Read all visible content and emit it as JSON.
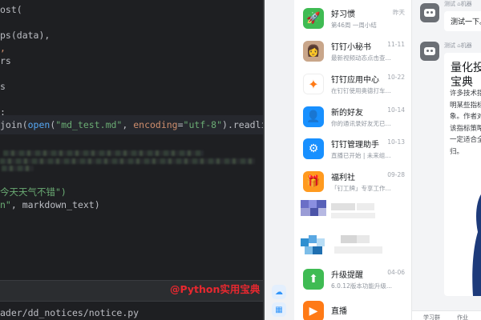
{
  "editor": {
    "code_lines": [
      {
        "id": "l1",
        "parts": [
          [
            "",
            "ost("
          ]
        ]
      },
      {
        "id": "l2",
        "parts": [
          [
            "",
            "ps(data),"
          ]
        ]
      },
      {
        "id": "l3",
        "parts": [
          [
            "tok-orange",
            ","
          ]
        ]
      },
      {
        "id": "l4",
        "parts": [
          [
            "",
            "rs"
          ]
        ]
      },
      {
        "id": "l5",
        "parts": [
          [
            "",
            "s"
          ]
        ]
      },
      {
        "id": "l6",
        "parts": [
          [
            "",
            ":"
          ]
        ]
      },
      {
        "id": "l7",
        "parts": [
          [
            "",
            "join("
          ],
          [
            "tok-fn",
            "open"
          ],
          [
            "",
            "("
          ],
          [
            "tok-str",
            "\"md_test.md\""
          ],
          [
            "",
            ", "
          ],
          [
            "tok-orange",
            "encoding"
          ],
          [
            "",
            "="
          ],
          [
            "tok-str",
            "\"utf-8\""
          ],
          [
            "",
            ")."
          ],
          [
            "",
            "readlines"
          ],
          [
            "paren-hl",
            "()"
          ],
          [
            "",
            ")"
          ]
        ]
      },
      {
        "id": "l8",
        "parts": [
          [
            "tok-str",
            "今天天气不错\")"
          ]
        ]
      },
      {
        "id": "l9",
        "parts": [
          [
            "tok-str",
            "n\""
          ],
          [
            "",
            ", markdown_text)"
          ]
        ]
      }
    ],
    "path": "ader/dd_notices/notice.py",
    "watermark": "@Python实用宝典"
  },
  "conversations": [
    {
      "id": "haoxiguan",
      "title": "好习惯",
      "preview": "第46周 一周小结",
      "time": "昨天",
      "avatar_color": "#3fbb53",
      "icon": "rocket-icon",
      "glyph": "🚀"
    },
    {
      "id": "dingding-mishu",
      "title": "钉钉小秘书",
      "preview": "最新视频动态点击查...",
      "time": "11-11",
      "avatar_color": "#c9a68a",
      "icon": "assistant-avatar",
      "glyph": "👩"
    },
    {
      "id": "app-center",
      "title": "钉钉应用中心",
      "preview": "在钉钉使用奥德打车...",
      "time": "10-22",
      "avatar_color": "#ffffff",
      "icon": "pinwheel-icon",
      "glyph": "✦"
    },
    {
      "id": "new-friend",
      "title": "新的好友",
      "preview": "你的通讯录好友无已...",
      "time": "10-14",
      "avatar_color": "#1890ff",
      "icon": "add-user-icon",
      "glyph": "👤"
    },
    {
      "id": "dd-manager",
      "title": "钉钉管理助手",
      "preview": "直播已开始 | 未来组...",
      "time": "10-13",
      "avatar_color": "#1890ff",
      "icon": "admin-user-icon",
      "glyph": "⚙"
    },
    {
      "id": "fulishe",
      "title": "福利社",
      "preview": "「钉工牌」专享工作...",
      "time": "09-28",
      "avatar_color": "#ff9a1f",
      "icon": "gift-icon",
      "glyph": "🎁"
    },
    {
      "id": "upgrade",
      "title": "升级提醒",
      "preview": "6.0.12版本功能升级...",
      "time": "04-06",
      "avatar_color": "#3fbb53",
      "icon": "upload-arrow-icon",
      "glyph": "⬆"
    },
    {
      "id": "live",
      "title": "直播",
      "preview": "",
      "time": "",
      "avatar_color": "#ff7a16",
      "icon": "live-play-icon",
      "glyph": "▶"
    }
  ],
  "chat": {
    "msg1_sender": "测试",
    "msg1_tag": "机器",
    "msg1_text": "测试一下。",
    "msg2_sender": "测试",
    "msg2_tag": "机器",
    "card_title_1": "量化投",
    "card_title_2": "宝典",
    "card_lines": [
      "许多技术指",
      "明某些指标",
      "象。作者对",
      "该指标策略",
      "一定适合全",
      "归。"
    ],
    "tabs": [
      "学习群",
      "作业"
    ]
  }
}
